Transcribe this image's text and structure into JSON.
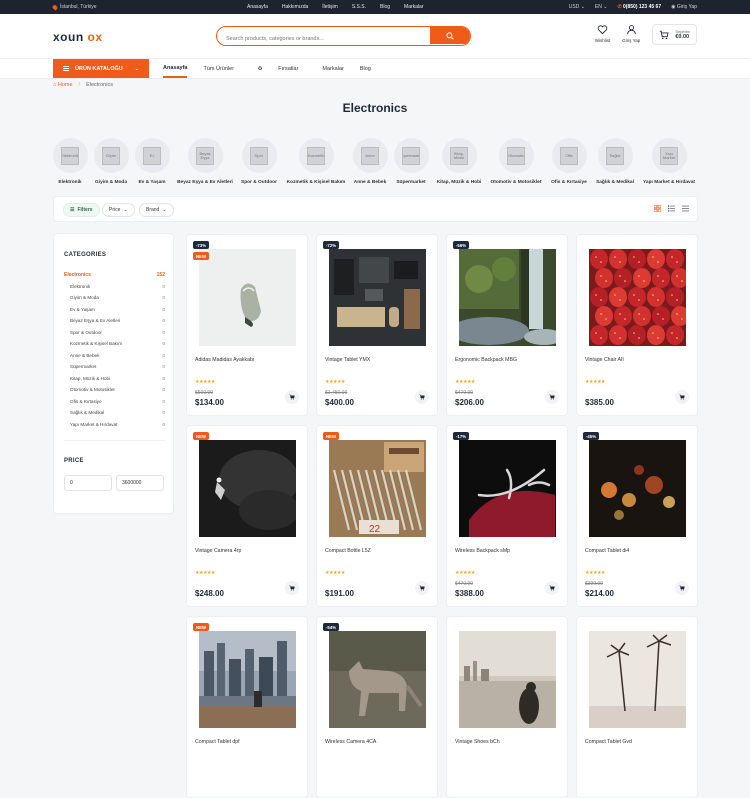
{
  "topbar": {
    "location": "İstanbul, Türkiye",
    "nav": [
      "Anasayfa",
      "Hakkımızda",
      "İletişim",
      "S.S.S.",
      "Blog",
      "Markalar"
    ],
    "currency": "USD",
    "language": "EN",
    "phone": "0(850) 123 45 67",
    "login": "Giriş Yap"
  },
  "header": {
    "logo_part1": "xoun",
    "logo_part2": "ox",
    "search_placeholder": "Search products, categories or brands...",
    "wishlist_label": "Wishlist",
    "login_label": "Giriş Yap",
    "cart_label": "Sepetim",
    "cart_total": "€0.00"
  },
  "menubar": {
    "catalog_label": "ÜRÜN KATALOĞU",
    "items": [
      "Anasayfa",
      "Tüm Ürünler",
      "Fırsatlar",
      "Markalar",
      "Blog"
    ]
  },
  "breadcrumb": {
    "home": "Home",
    "current": "Electronics"
  },
  "page_title": "Electronics",
  "categories": [
    {
      "label": "Elektronik",
      "thumb": "Elektronik"
    },
    {
      "label": "Giyim & Moda",
      "thumb": "Giyim"
    },
    {
      "label": "Ev & Yaşam",
      "thumb": "Ev"
    },
    {
      "label": "Beyaz Eşya & Ev Aletleri",
      "thumb": "Beyaz Eşya"
    },
    {
      "label": "Spor & Outdoor",
      "thumb": "Spor"
    },
    {
      "label": "Kozmetik & Kişisel Bakım",
      "thumb": "Kozmetik"
    },
    {
      "label": "Anne & Bebek",
      "thumb": "Anne"
    },
    {
      "label": "Süpermarket",
      "thumb": "Süpermarket"
    },
    {
      "label": "Kitap, Müzik & Hobi",
      "thumb": "Kitap, Müzik"
    },
    {
      "label": "Otomotiv & Motosiklet",
      "thumb": "Otomotiv"
    },
    {
      "label": "Ofis & Kırtasiye",
      "thumb": "Ofis"
    },
    {
      "label": "Sağlık & Medikal",
      "thumb": "Sağlık"
    },
    {
      "label": "Yapı Market & Hırdavat",
      "thumb": "Yapı Market"
    }
  ],
  "filters": {
    "main": "Filters",
    "price": "Price",
    "brand": "Brand"
  },
  "sidebar": {
    "categories_title": "CATEGORIES",
    "top": {
      "label": "Electronics",
      "count": "152"
    },
    "items": [
      {
        "label": "Elektronik",
        "count": "0"
      },
      {
        "label": "Giyim & Moda",
        "count": "0"
      },
      {
        "label": "Ev & Yaşam",
        "count": "0"
      },
      {
        "label": "Beyaz Eşya & Ev Aletleri",
        "count": "0"
      },
      {
        "label": "Spor & Outdoor",
        "count": "0"
      },
      {
        "label": "Kozmetik & Kişisel Bakım",
        "count": "0"
      },
      {
        "label": "Anne & Bebek",
        "count": "0"
      },
      {
        "label": "Süpermarket",
        "count": "0"
      },
      {
        "label": "Kitap, Müzik & Hobi",
        "count": "0"
      },
      {
        "label": "Otomotiv & Motosiklet",
        "count": "0"
      },
      {
        "label": "Ofis & Kırtasiye",
        "count": "0"
      },
      {
        "label": "Sağlık & Medikal",
        "count": "0"
      },
      {
        "label": "Yapı Market & Hırdavat",
        "count": "0"
      }
    ],
    "price_title": "PRICE",
    "price_min": "0",
    "price_max": "3600000"
  },
  "products": [
    {
      "name": "Adidas Madidas Ayakkabı",
      "discount": "-73%",
      "new": "NEW",
      "old_price": "$500.00",
      "price": "$134.00",
      "rating": 4.5,
      "image": "sneaker"
    },
    {
      "name": "Vintage Tablet YMX",
      "discount": "-72%",
      "new": "",
      "old_price": "$1,450.00",
      "price": "$400.00",
      "rating": 4.5,
      "image": "desk"
    },
    {
      "name": "Ergonomic Backpack MBG",
      "discount": "-56%",
      "new": "",
      "old_price": "$470.00",
      "price": "$206.00",
      "rating": 4.5,
      "image": "waterfall"
    },
    {
      "name": "Vintage Chair AII",
      "discount": "",
      "new": "",
      "old_price": "",
      "price": "$385.00",
      "rating": 4.5,
      "image": "strawberries"
    },
    {
      "name": "Vintage Camera 4rp",
      "discount": "",
      "new": "NEW",
      "old_price": "",
      "price": "$248.00",
      "rating": 4.5,
      "image": "diver"
    },
    {
      "name": "Compact Bottle L5Z",
      "discount": "",
      "new": "NEW",
      "old_price": "",
      "price": "$191.00",
      "rating": 4.5,
      "image": "pencils"
    },
    {
      "name": "Wireless Backpack sMp",
      "discount": "-17%",
      "new": "",
      "old_price": "$470.00",
      "price": "$388.00",
      "rating": 4.5,
      "image": "antler"
    },
    {
      "name": "Compact Tablet di4",
      "discount": "-45%",
      "new": "",
      "old_price": "$390.00",
      "price": "$214.00",
      "rating": 4.5,
      "image": "bokeh"
    },
    {
      "name": "Compact Tablet dpf",
      "discount": "",
      "new": "NEW",
      "old_price": "",
      "price": "",
      "rating": 0,
      "image": "city"
    },
    {
      "name": "Wireless Camera 4CA",
      "discount": "-54%",
      "new": "",
      "old_price": "",
      "price": "",
      "rating": 0,
      "image": "coyote"
    },
    {
      "name": "Vintage Shoes bCh",
      "discount": "",
      "new": "",
      "old_price": "",
      "price": "",
      "rating": 0,
      "image": "beach"
    },
    {
      "name": "Compact Tablet Gvd",
      "discount": "",
      "new": "",
      "old_price": "",
      "price": "",
      "rating": 0,
      "image": "palms"
    }
  ],
  "colors": {
    "accent": "#ef5b19",
    "dark": "#1e2a3b",
    "star": "#f2a61a"
  }
}
